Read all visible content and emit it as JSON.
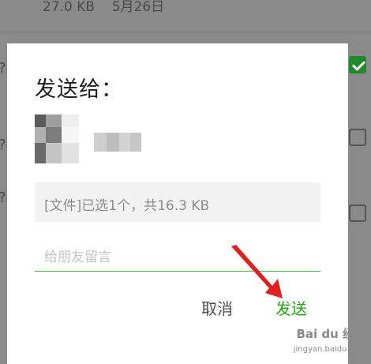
{
  "background": {
    "top_row": {
      "size": "27.0 KB",
      "date": "5月26日"
    },
    "row_markers": [
      "?",
      "?",
      "?",
      "?"
    ]
  },
  "dialog": {
    "title": "发送给：",
    "contact": {
      "avatar": "blurred-avatar",
      "name": "blurred-name"
    },
    "file_summary": "[文件]已选1个，共16.3 KB",
    "message_placeholder": "给朋友留言",
    "cancel_label": "取消",
    "send_label": "发送"
  },
  "colors": {
    "accent_green": "#2aa515",
    "input_underline": "#44b549",
    "annotation_red": "#e02020"
  },
  "watermark": {
    "brand": "Bai du 经验",
    "url": "jingyan.baidu.com"
  }
}
